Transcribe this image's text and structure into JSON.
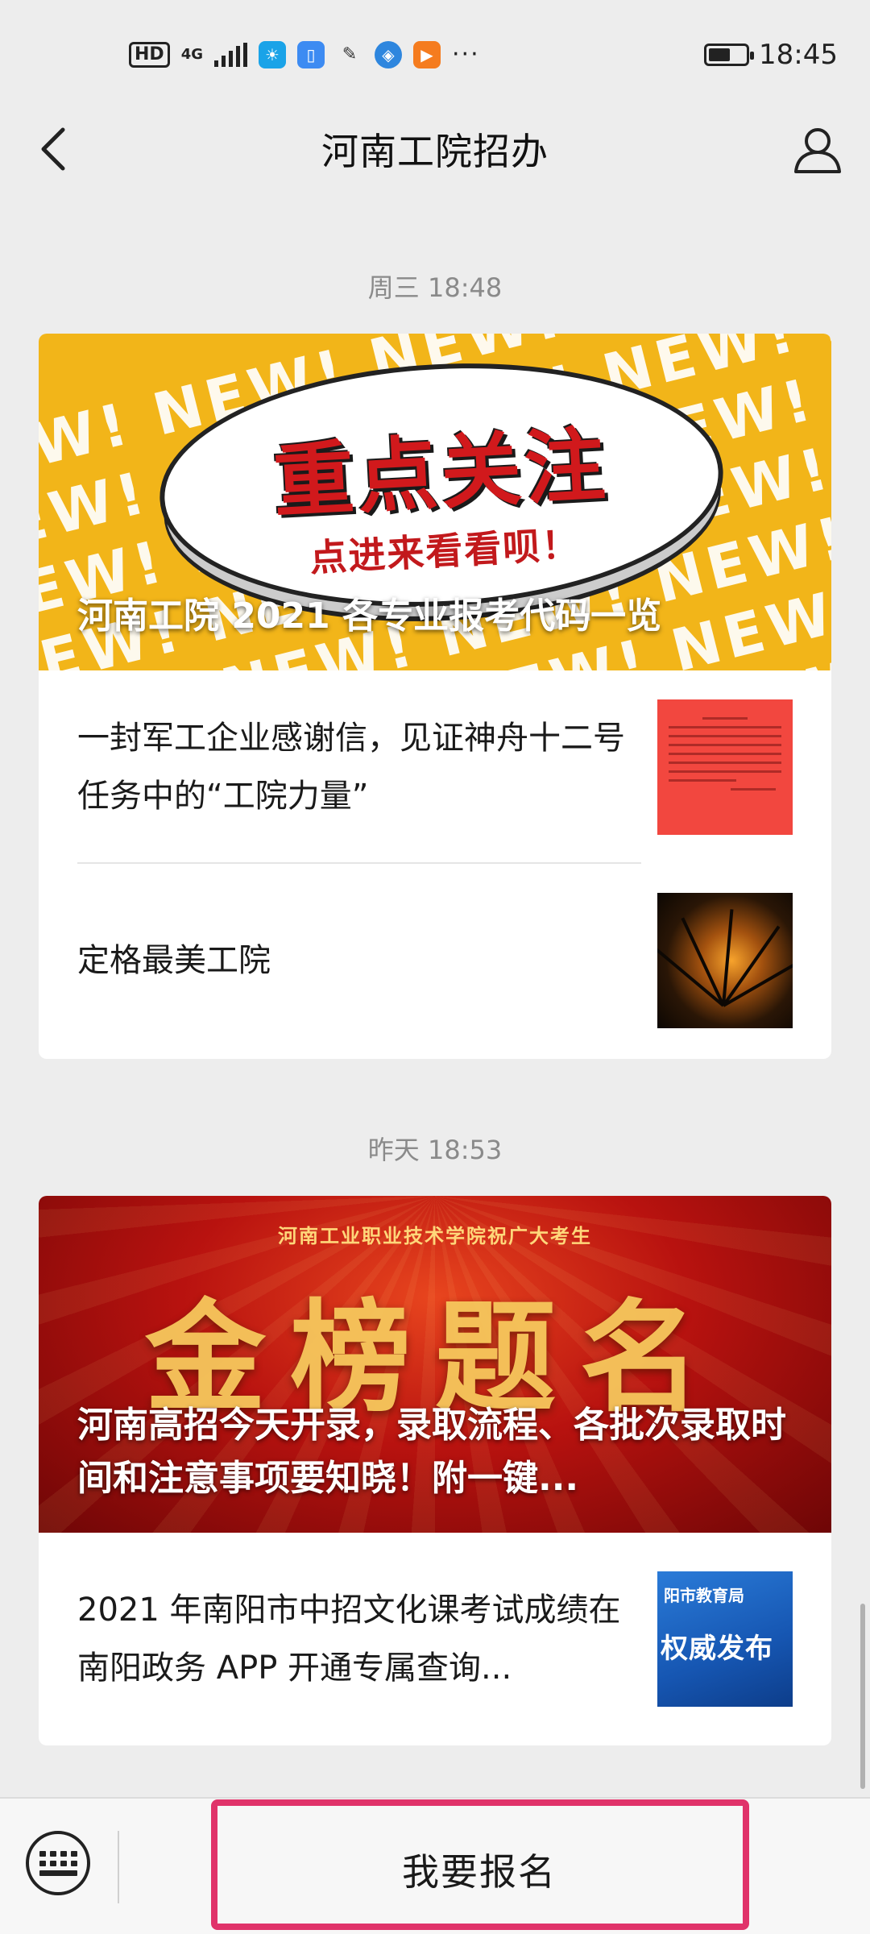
{
  "status_bar": {
    "badge": "HD",
    "network": "4G",
    "time": "18:45",
    "battery_level": 0.6,
    "more": "···"
  },
  "header": {
    "title": "河南工院招办",
    "back_icon": "chevron-left-icon",
    "profile_icon": "user-icon"
  },
  "feed": [
    {
      "time": "周三 18:48",
      "banner": {
        "title": "河南工院 2021 各专业报考代码一览",
        "art_repeat": "NEW!",
        "art_main": "重点关注",
        "art_sub": "点进来看看呗！"
      },
      "items": [
        {
          "title": "一封军工企业感谢信，见证神舟十二号任务中的“工院力量”",
          "thumb": "letter"
        },
        {
          "title": "定格最美工院",
          "thumb": "sunset"
        }
      ]
    },
    {
      "time": "昨天 18:53",
      "banner": {
        "title": "河南高招今天开录，录取流程、各批次录取时间和注意事项要知晓！附一键...",
        "art_top": "河南工业职业技术学院祝广大考生",
        "art_main": "金榜题名"
      },
      "items": [
        {
          "title": "2021 年南阳市中招文化课考试成绩在南阳政务 APP 开通专属查询...",
          "thumb": "blue",
          "thumb_top": "阳市教育局",
          "thumb_main": "权威发布"
        }
      ]
    }
  ],
  "bottom_bar": {
    "keyboard_icon": "keyboard-icon",
    "menu_label": "我要报名"
  },
  "colors": {
    "highlight": "#e0336a",
    "background": "#ededed"
  }
}
